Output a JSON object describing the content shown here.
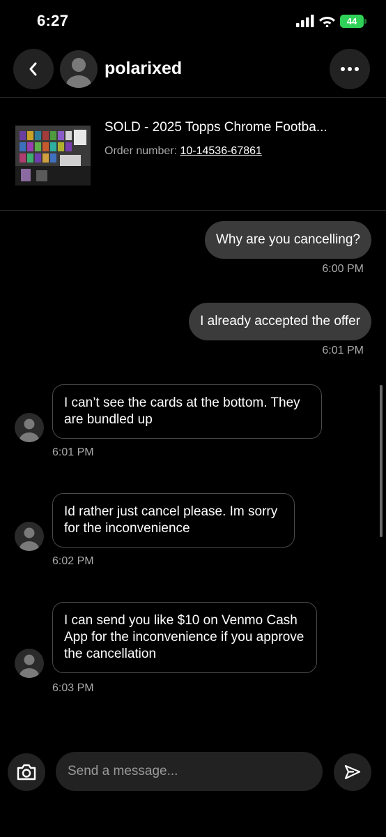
{
  "status_bar": {
    "time": "6:27",
    "battery": "44",
    "icons": [
      "cellular-signal-icon",
      "wifi-icon",
      "battery-icon"
    ]
  },
  "header": {
    "username": "polarixed",
    "back_icon": "chevron-left-icon",
    "more_icon": "more-horizontal-icon"
  },
  "listing": {
    "title": "SOLD - 2025 Topps Chrome Footba...",
    "order_label": "Order number: ",
    "order_number": "10-14536-67861"
  },
  "messages": [
    {
      "direction": "outgoing",
      "text": "Why are you cancelling?",
      "time": "6:00 PM"
    },
    {
      "direction": "outgoing",
      "text": "I already accepted the offer",
      "time": "6:01 PM"
    },
    {
      "direction": "incoming",
      "text": "I can’t see the cards at the bottom. They are bundled up",
      "time": "6:01 PM"
    },
    {
      "direction": "incoming",
      "text": "Id rather just cancel please. Im sorry for the inconvenience",
      "time": "6:02 PM"
    },
    {
      "direction": "incoming",
      "text": "I can send you like $10 on Venmo Cash App for the inconvenience if you approve the cancellation",
      "time": "6:03 PM"
    }
  ],
  "composer": {
    "placeholder": "Send a message...",
    "camera_icon": "camera-icon",
    "send_icon": "send-icon"
  },
  "colors": {
    "background": "#000000",
    "outgoing_bubble": "#3b3b3b",
    "incoming_border": "#4a4a4a",
    "battery_green": "#30d158"
  }
}
